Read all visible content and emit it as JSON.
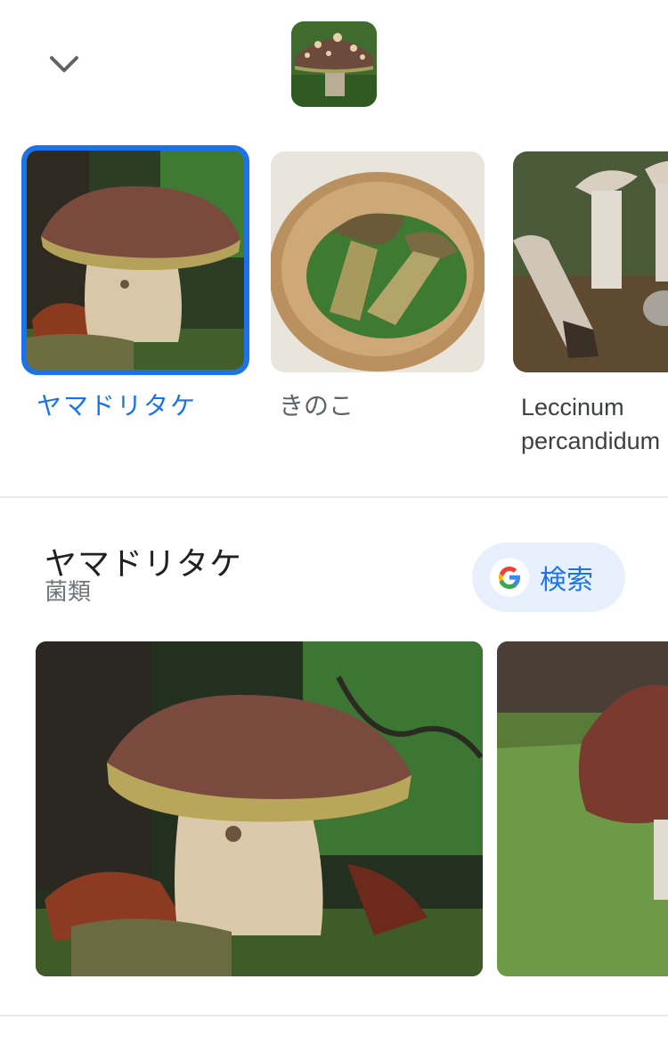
{
  "header": {
    "collapse_icon": "chevron-down-icon",
    "thumbnail_subject": "mushroom"
  },
  "results": [
    {
      "label": "ヤマドリタケ",
      "selected": true
    },
    {
      "label": "きのこ",
      "selected": false
    },
    {
      "label": "Leccinum percandidum",
      "selected": false
    }
  ],
  "knowledge_panel": {
    "title": "ヤマドリタケ",
    "subtitle": "菌類",
    "search_button_label": "検索",
    "search_icon": "google-g-icon"
  },
  "colors": {
    "accent": "#1a73e8",
    "chip_bg": "#e8f0fe",
    "divider": "#e8eaed"
  }
}
